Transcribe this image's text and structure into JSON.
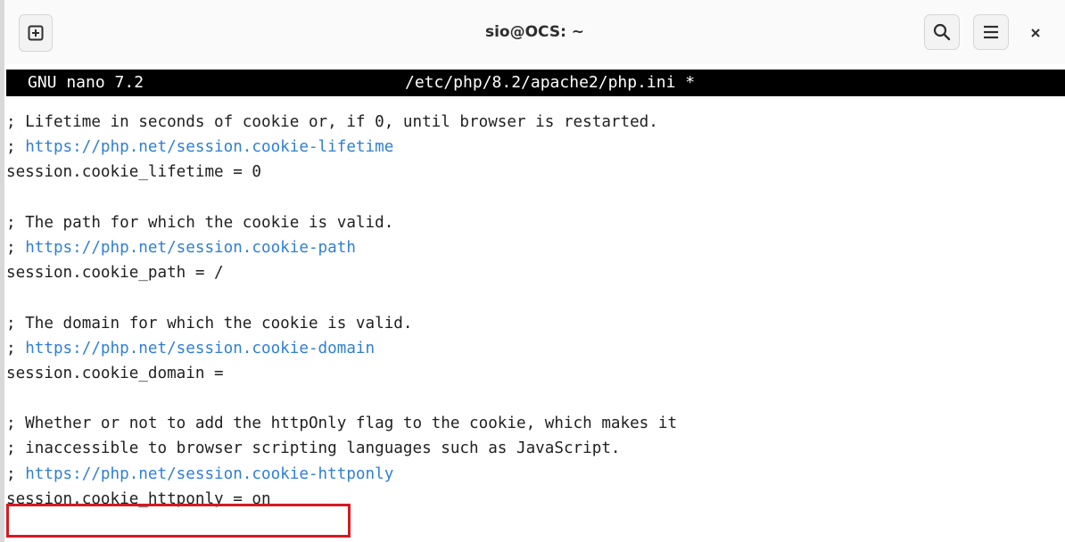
{
  "window": {
    "title": "sio@OCS: ~",
    "icons": {
      "new_tab": "new-tab-plus-icon",
      "search": "search-icon",
      "menu": "hamburger-menu-icon",
      "close": "close-icon"
    }
  },
  "nano": {
    "version": "GNU nano 7.2",
    "file": "/etc/php/8.2/apache2/php.ini *"
  },
  "editor": {
    "lines": [
      {
        "text": "; Lifetime in seconds of cookie or, if 0, until browser is restarted.",
        "kind": "comment"
      },
      {
        "text": "https://php.net/session.cookie-lifetime",
        "kind": "link"
      },
      {
        "text": "session.cookie_lifetime = 0",
        "kind": "setting"
      },
      {
        "text": "",
        "kind": "blank"
      },
      {
        "text": "; The path for which the cookie is valid.",
        "kind": "comment"
      },
      {
        "text": "https://php.net/session.cookie-path",
        "kind": "link"
      },
      {
        "text": "session.cookie_path = /",
        "kind": "setting"
      },
      {
        "text": "",
        "kind": "blank"
      },
      {
        "text": "; The domain for which the cookie is valid.",
        "kind": "comment"
      },
      {
        "text": "https://php.net/session.cookie-domain",
        "kind": "link"
      },
      {
        "text": "session.cookie_domain =",
        "kind": "setting"
      },
      {
        "text": "",
        "kind": "blank"
      },
      {
        "text": "; Whether or not to add the httpOnly flag to the cookie, which makes it",
        "kind": "comment"
      },
      {
        "text": "; inaccessible to browser scripting languages such as JavaScript.",
        "kind": "comment"
      },
      {
        "text": "https://php.net/session.cookie-httponly",
        "kind": "link"
      },
      {
        "text": "session.cookie_httponly = on",
        "kind": "setting"
      }
    ]
  },
  "colors": {
    "link": "#2f7fd6",
    "highlight_border": "#d9191f",
    "nano_header_bg": "#000000"
  }
}
